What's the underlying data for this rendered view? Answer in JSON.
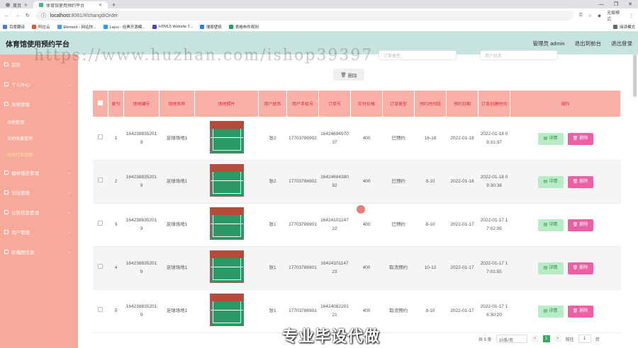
{
  "browser": {
    "tabs": [
      {
        "label": "首页"
      },
      {
        "label": "体育馆使用预约平台"
      }
    ],
    "url_host": "localhost",
    "url_path": ":8081/#/changdiOrder",
    "profile_label": "无痕模式",
    "bookmarks": [
      "百度翻译",
      "阿拉云",
      "Element - 网站快...",
      "Layui - 经典开源模...",
      "HTML5 Website T...",
      "搜索壁纸",
      "表格构件规则"
    ],
    "reading_mode": "阅读模式"
  },
  "header": {
    "title": "体育馆使用预约平台",
    "user_label": "管理员 admin",
    "back_label": "退出到前台",
    "logout_label": "退出登录"
  },
  "sidebar": {
    "items": [
      {
        "label": "首页",
        "has_children": false
      },
      {
        "label": "个人中心",
        "has_children": true
      },
      {
        "label": "场地管理",
        "has_children": true
      },
      {
        "label": "场地管理",
        "sub": true,
        "active": false
      },
      {
        "label": "场地收藏管理",
        "sub": true,
        "active": false
      },
      {
        "label": "场地订单管理",
        "sub": true,
        "active": true
      },
      {
        "label": "器材借还管理",
        "has_children": true
      },
      {
        "label": "论坛管理",
        "has_children": true
      },
      {
        "label": "公告信息管理",
        "has_children": true
      },
      {
        "label": "用户管理",
        "has_children": true
      },
      {
        "label": "轮播图信息",
        "has_children": true
      }
    ]
  },
  "toolbar": {
    "delete_label": "删除"
  },
  "filters": {
    "order_type_placeholder": "订单类型",
    "user_name_placeholder": "用户姓名"
  },
  "table": {
    "headers": [
      "索引",
      "场地编号",
      "场地名称",
      "场地照片",
      "用户姓名",
      "用户手机号",
      "订单号",
      "实付价格",
      "订单类型",
      "预约时间段",
      "预约日期",
      "订单创建时间",
      "操作"
    ],
    "rows": [
      {
        "index": "1",
        "code": "1642388352019",
        "name": "足球场地1",
        "user": "张2",
        "phone": "17703786902",
        "order_no": "1642469497037",
        "price": "400",
        "type": "已预约",
        "slot": "16-18",
        "date": "2022-01-19",
        "created": "2022-01-18 09:31:37"
      },
      {
        "index": "2",
        "code": "1642388352019",
        "name": "足球场地1",
        "user": "张2",
        "phone": "17703786902",
        "order_no": "1642469438092",
        "price": "400",
        "type": "已预约",
        "slot": "8-10",
        "date": "2022-01-18",
        "created": "2022-01-18 09:30:38"
      },
      {
        "index": "3",
        "code": "1642388352019",
        "name": "足球场地1",
        "user": "张1",
        "phone": "17703786901",
        "order_no": "1642410124722",
        "price": "400",
        "type": "已预约",
        "slot": "8-10",
        "date": "2022-01-17",
        "created": "2022-01-17 17:02:05"
      },
      {
        "index": "4",
        "code": "1642388352019",
        "name": "足球场地1",
        "user": "张1",
        "phone": "17703786901",
        "order_no": "1642410114723",
        "price": "400",
        "type": "取消预约",
        "slot": "10-12",
        "date": "2022-01-17",
        "created": "2022-01-17 17:01:55"
      },
      {
        "index": "5",
        "code": "1642388352019",
        "name": "足球场地1",
        "user": "张1",
        "phone": "17703786901",
        "order_no": "1642408220121",
        "price": "400",
        "type": "取消预约",
        "slot": "8-10",
        "date": "2022-01-17",
        "created": "2022-01-17 16:30:20"
      }
    ],
    "detail_label": "详情",
    "delete_label": "删除"
  },
  "pagination": {
    "total_label": "共 5 条",
    "page_size": "10条/页",
    "prev": "<",
    "current": "1",
    "next": ">",
    "goto_label": "前往",
    "goto_value": "1",
    "page_unit": "页"
  },
  "overlays": {
    "watermark": "https://www.huzhan.com/ishop39397",
    "caption": "专业毕设代做"
  },
  "colors": {
    "header_bg": "#c6e3df",
    "sidebar_bg": "#f7a99a",
    "table_head_bg": "#f9b0a5",
    "detail_btn": "#b8ecc6",
    "delete_btn": "#ee5fa4",
    "page_active": "#3aa960"
  }
}
